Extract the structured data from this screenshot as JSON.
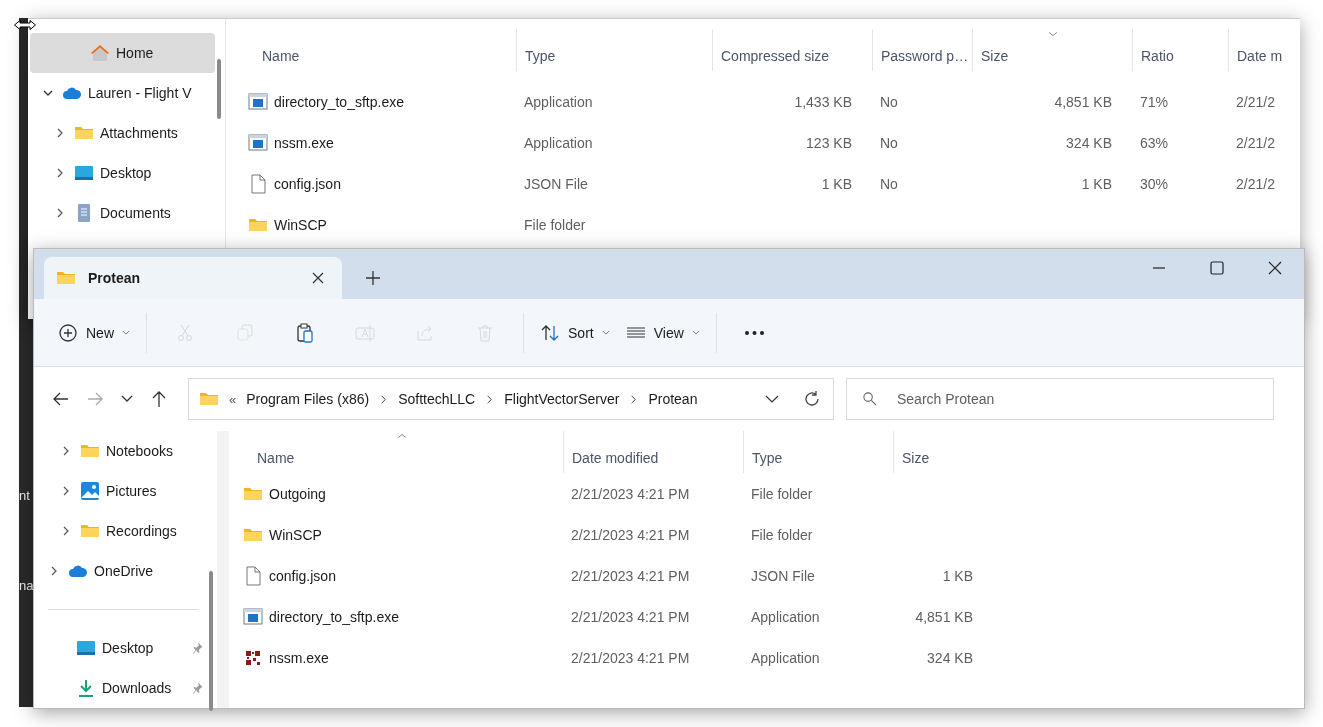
{
  "backdrop": {
    "fragments": [
      "nt",
      "na"
    ]
  },
  "back_window": {
    "sidebar": [
      {
        "label": "Home",
        "kind": "home",
        "selected": true
      },
      {
        "label": "Lauren - Flight V",
        "kind": "cloud",
        "selected": false,
        "expanded": true,
        "children": [
          {
            "label": "Attachments",
            "kind": "folder",
            "selected": false,
            "expanded": false
          },
          {
            "label": "Desktop",
            "kind": "desktop",
            "selected": false,
            "expanded": false
          },
          {
            "label": "Documents",
            "kind": "document",
            "selected": false,
            "expanded": false
          }
        ]
      }
    ],
    "sort_descending": true,
    "columns": [
      {
        "label": "Name",
        "kind": "text",
        "sorted": false
      },
      {
        "label": "Type",
        "kind": "text",
        "sorted": false
      },
      {
        "label": "Compressed size",
        "kind": "number",
        "sorted": false
      },
      {
        "label": "Password p…",
        "kind": "text",
        "sorted": false
      },
      {
        "label": "Size",
        "kind": "number",
        "sorted": true
      },
      {
        "label": "Ratio",
        "kind": "text",
        "sorted": false
      },
      {
        "label": "Date m",
        "kind": "text",
        "sorted": false
      }
    ],
    "rows": [
      {
        "kind": "app",
        "cells": [
          "directory_to_sftp.exe",
          "Application",
          "1,433 KB",
          "No",
          "4,851 KB",
          "71%",
          "2/21/2"
        ]
      },
      {
        "kind": "app",
        "cells": [
          "nssm.exe",
          "Application",
          "123 KB",
          "No",
          "324 KB",
          "63%",
          "2/21/2"
        ]
      },
      {
        "kind": "file",
        "cells": [
          "config.json",
          "JSON File",
          "1 KB",
          "No",
          "1 KB",
          "30%",
          "2/21/2"
        ]
      },
      {
        "kind": "folder",
        "cells": [
          "WinSCP",
          "File folder"
        ]
      }
    ]
  },
  "window": {
    "tabs": [
      {
        "label": "Protean",
        "selected": true
      }
    ],
    "toolbar": [
      {
        "kind": "new",
        "label": "New",
        "disabled": false
      },
      {
        "kind": "separator"
      },
      {
        "kind": "cut",
        "disabled": true
      },
      {
        "kind": "copy",
        "disabled": true
      },
      {
        "kind": "paste",
        "disabled": false
      },
      {
        "kind": "rename",
        "disabled": true
      },
      {
        "kind": "share",
        "disabled": true
      },
      {
        "kind": "delete",
        "disabled": true
      },
      {
        "kind": "separator"
      },
      {
        "kind": "sort",
        "label": "Sort",
        "disabled": false
      },
      {
        "kind": "view",
        "label": "View",
        "disabled": false
      },
      {
        "kind": "separator"
      },
      {
        "kind": "more",
        "disabled": false
      }
    ],
    "nav": {
      "forward_disabled": true
    },
    "address": {
      "overflow": "«",
      "segments": [
        "Program Files (x86)",
        "SofttechLLC",
        "FlightVectorServer",
        "Protean"
      ]
    },
    "search": {
      "placeholder": "Search Protean"
    },
    "sidebar": {
      "nested": [
        {
          "label": "Notebooks",
          "kind": "folder",
          "expanded": false
        },
        {
          "label": "Pictures",
          "kind": "pictures",
          "expanded": false
        },
        {
          "label": "Recordings",
          "kind": "folder",
          "expanded": false
        }
      ],
      "roots": [
        {
          "label": "OneDrive",
          "kind": "cloud",
          "expanded": false
        }
      ],
      "pinned": [
        {
          "label": "Desktop",
          "kind": "desktop",
          "pinned": true
        },
        {
          "label": "Downloads",
          "kind": "download",
          "pinned": true
        }
      ]
    },
    "sort_descending": false,
    "columns": [
      {
        "label": "Name",
        "kind": "text",
        "sorted": true
      },
      {
        "label": "Date modified",
        "kind": "text",
        "sorted": false
      },
      {
        "label": "Type",
        "kind": "text",
        "sorted": false
      },
      {
        "label": "Size",
        "kind": "number",
        "sorted": false
      }
    ],
    "rows": [
      {
        "kind": "folder",
        "cells": [
          "Outgoing",
          "2/21/2023 4:21 PM",
          "File folder"
        ]
      },
      {
        "kind": "folder",
        "cells": [
          "WinSCP",
          "2/21/2023 4:21 PM",
          "File folder"
        ]
      },
      {
        "kind": "file",
        "cells": [
          "config.json",
          "2/21/2023 4:21 PM",
          "JSON File",
          "1 KB"
        ]
      },
      {
        "kind": "app",
        "cells": [
          "directory_to_sftp.exe",
          "2/21/2023 4:21 PM",
          "Application",
          "4,851 KB"
        ]
      },
      {
        "kind": "nssm",
        "cells": [
          "nssm.exe",
          "2/21/2023 4:21 PM",
          "Application",
          "324 KB"
        ]
      }
    ]
  }
}
